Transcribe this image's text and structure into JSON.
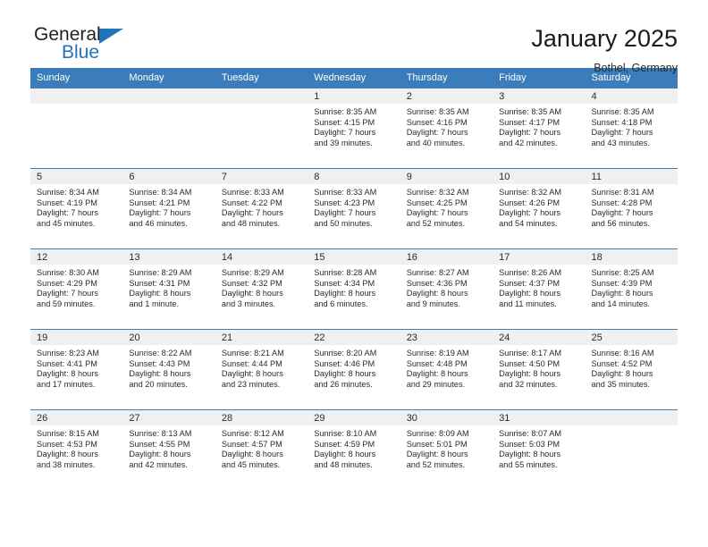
{
  "brand": {
    "name_top": "General",
    "name_bottom": "Blue",
    "triangle_icon": "logo-triangle-icon",
    "accent_color": "#1f74bb"
  },
  "header": {
    "title": "January 2025",
    "subtitle": "Bothel, Germany"
  },
  "theme": {
    "header_bar_color": "#3a7dba",
    "date_band_color": "#f0f0f0",
    "text_color": "#2b2b2b"
  },
  "weekday_headers": [
    "Sunday",
    "Monday",
    "Tuesday",
    "Wednesday",
    "Thursday",
    "Friday",
    "Saturday"
  ],
  "weeks": [
    [
      {
        "date": "",
        "lines": []
      },
      {
        "date": "",
        "lines": []
      },
      {
        "date": "",
        "lines": []
      },
      {
        "date": "1",
        "lines": [
          "Sunrise: 8:35 AM",
          "Sunset: 4:15 PM",
          "Daylight: 7 hours",
          "and 39 minutes."
        ]
      },
      {
        "date": "2",
        "lines": [
          "Sunrise: 8:35 AM",
          "Sunset: 4:16 PM",
          "Daylight: 7 hours",
          "and 40 minutes."
        ]
      },
      {
        "date": "3",
        "lines": [
          "Sunrise: 8:35 AM",
          "Sunset: 4:17 PM",
          "Daylight: 7 hours",
          "and 42 minutes."
        ]
      },
      {
        "date": "4",
        "lines": [
          "Sunrise: 8:35 AM",
          "Sunset: 4:18 PM",
          "Daylight: 7 hours",
          "and 43 minutes."
        ]
      }
    ],
    [
      {
        "date": "5",
        "lines": [
          "Sunrise: 8:34 AM",
          "Sunset: 4:19 PM",
          "Daylight: 7 hours",
          "and 45 minutes."
        ]
      },
      {
        "date": "6",
        "lines": [
          "Sunrise: 8:34 AM",
          "Sunset: 4:21 PM",
          "Daylight: 7 hours",
          "and 46 minutes."
        ]
      },
      {
        "date": "7",
        "lines": [
          "Sunrise: 8:33 AM",
          "Sunset: 4:22 PM",
          "Daylight: 7 hours",
          "and 48 minutes."
        ]
      },
      {
        "date": "8",
        "lines": [
          "Sunrise: 8:33 AM",
          "Sunset: 4:23 PM",
          "Daylight: 7 hours",
          "and 50 minutes."
        ]
      },
      {
        "date": "9",
        "lines": [
          "Sunrise: 8:32 AM",
          "Sunset: 4:25 PM",
          "Daylight: 7 hours",
          "and 52 minutes."
        ]
      },
      {
        "date": "10",
        "lines": [
          "Sunrise: 8:32 AM",
          "Sunset: 4:26 PM",
          "Daylight: 7 hours",
          "and 54 minutes."
        ]
      },
      {
        "date": "11",
        "lines": [
          "Sunrise: 8:31 AM",
          "Sunset: 4:28 PM",
          "Daylight: 7 hours",
          "and 56 minutes."
        ]
      }
    ],
    [
      {
        "date": "12",
        "lines": [
          "Sunrise: 8:30 AM",
          "Sunset: 4:29 PM",
          "Daylight: 7 hours",
          "and 59 minutes."
        ]
      },
      {
        "date": "13",
        "lines": [
          "Sunrise: 8:29 AM",
          "Sunset: 4:31 PM",
          "Daylight: 8 hours",
          "and 1 minute."
        ]
      },
      {
        "date": "14",
        "lines": [
          "Sunrise: 8:29 AM",
          "Sunset: 4:32 PM",
          "Daylight: 8 hours",
          "and 3 minutes."
        ]
      },
      {
        "date": "15",
        "lines": [
          "Sunrise: 8:28 AM",
          "Sunset: 4:34 PM",
          "Daylight: 8 hours",
          "and 6 minutes."
        ]
      },
      {
        "date": "16",
        "lines": [
          "Sunrise: 8:27 AM",
          "Sunset: 4:36 PM",
          "Daylight: 8 hours",
          "and 9 minutes."
        ]
      },
      {
        "date": "17",
        "lines": [
          "Sunrise: 8:26 AM",
          "Sunset: 4:37 PM",
          "Daylight: 8 hours",
          "and 11 minutes."
        ]
      },
      {
        "date": "18",
        "lines": [
          "Sunrise: 8:25 AM",
          "Sunset: 4:39 PM",
          "Daylight: 8 hours",
          "and 14 minutes."
        ]
      }
    ],
    [
      {
        "date": "19",
        "lines": [
          "Sunrise: 8:23 AM",
          "Sunset: 4:41 PM",
          "Daylight: 8 hours",
          "and 17 minutes."
        ]
      },
      {
        "date": "20",
        "lines": [
          "Sunrise: 8:22 AM",
          "Sunset: 4:43 PM",
          "Daylight: 8 hours",
          "and 20 minutes."
        ]
      },
      {
        "date": "21",
        "lines": [
          "Sunrise: 8:21 AM",
          "Sunset: 4:44 PM",
          "Daylight: 8 hours",
          "and 23 minutes."
        ]
      },
      {
        "date": "22",
        "lines": [
          "Sunrise: 8:20 AM",
          "Sunset: 4:46 PM",
          "Daylight: 8 hours",
          "and 26 minutes."
        ]
      },
      {
        "date": "23",
        "lines": [
          "Sunrise: 8:19 AM",
          "Sunset: 4:48 PM",
          "Daylight: 8 hours",
          "and 29 minutes."
        ]
      },
      {
        "date": "24",
        "lines": [
          "Sunrise: 8:17 AM",
          "Sunset: 4:50 PM",
          "Daylight: 8 hours",
          "and 32 minutes."
        ]
      },
      {
        "date": "25",
        "lines": [
          "Sunrise: 8:16 AM",
          "Sunset: 4:52 PM",
          "Daylight: 8 hours",
          "and 35 minutes."
        ]
      }
    ],
    [
      {
        "date": "26",
        "lines": [
          "Sunrise: 8:15 AM",
          "Sunset: 4:53 PM",
          "Daylight: 8 hours",
          "and 38 minutes."
        ]
      },
      {
        "date": "27",
        "lines": [
          "Sunrise: 8:13 AM",
          "Sunset: 4:55 PM",
          "Daylight: 8 hours",
          "and 42 minutes."
        ]
      },
      {
        "date": "28",
        "lines": [
          "Sunrise: 8:12 AM",
          "Sunset: 4:57 PM",
          "Daylight: 8 hours",
          "and 45 minutes."
        ]
      },
      {
        "date": "29",
        "lines": [
          "Sunrise: 8:10 AM",
          "Sunset: 4:59 PM",
          "Daylight: 8 hours",
          "and 48 minutes."
        ]
      },
      {
        "date": "30",
        "lines": [
          "Sunrise: 8:09 AM",
          "Sunset: 5:01 PM",
          "Daylight: 8 hours",
          "and 52 minutes."
        ]
      },
      {
        "date": "31",
        "lines": [
          "Sunrise: 8:07 AM",
          "Sunset: 5:03 PM",
          "Daylight: 8 hours",
          "and 55 minutes."
        ]
      },
      {
        "date": "",
        "lines": []
      }
    ]
  ]
}
